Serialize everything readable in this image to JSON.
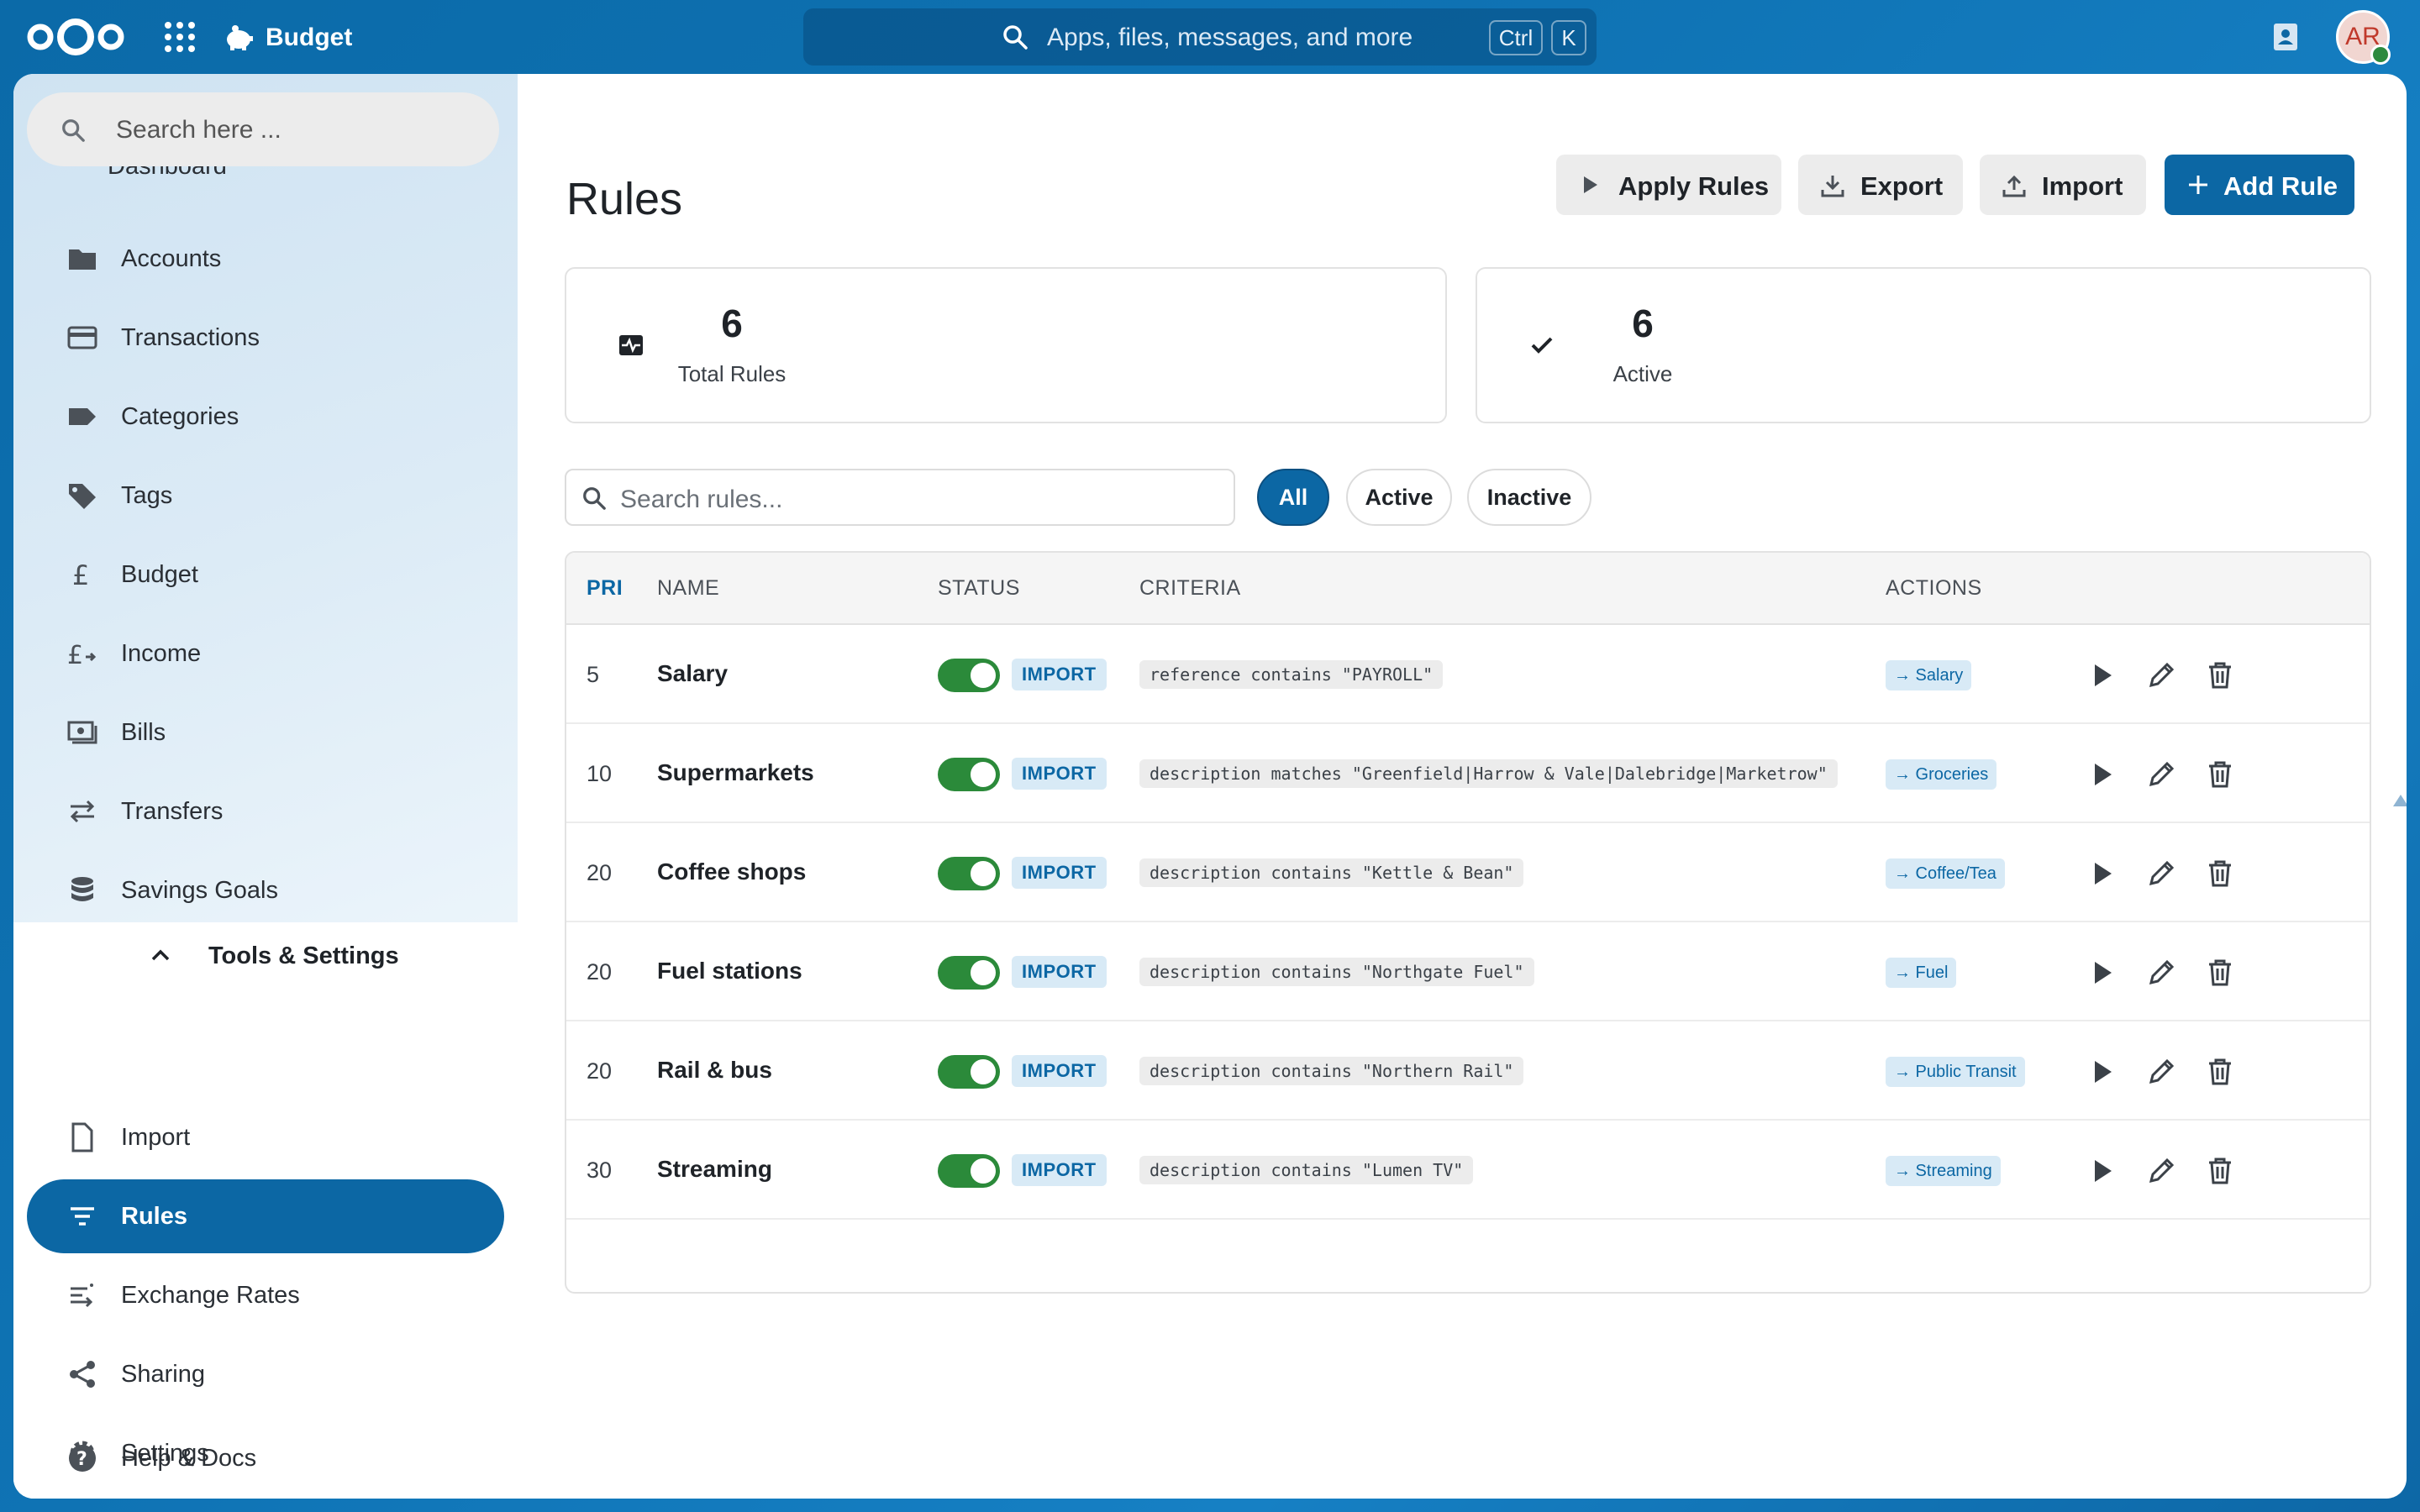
{
  "topbar": {
    "app_name": "Budget",
    "search_placeholder": "Apps, files, messages, and more",
    "shortcut_ctrl": "Ctrl",
    "shortcut_k": "K",
    "avatar_initials": "AR"
  },
  "sidebar": {
    "search_placeholder": "Search here ...",
    "cut_item": "Dashboard",
    "items": [
      {
        "label": "Accounts",
        "icon": "folder-icon"
      },
      {
        "label": "Transactions",
        "icon": "credit-card-icon"
      },
      {
        "label": "Categories",
        "icon": "label-icon"
      },
      {
        "label": "Tags",
        "icon": "tag-icon"
      },
      {
        "label": "Budget",
        "icon": "currency-icon"
      },
      {
        "label": "Income",
        "icon": "income-icon"
      },
      {
        "label": "Bills",
        "icon": "cash-icon"
      },
      {
        "label": "Transfers",
        "icon": "swap-icon"
      },
      {
        "label": "Savings Goals",
        "icon": "database-icon"
      }
    ],
    "tools_header": "Tools & Settings",
    "tools": [
      {
        "label": "Import",
        "icon": "file-icon"
      },
      {
        "label": "Rules",
        "icon": "filter-icon",
        "active": true
      },
      {
        "label": "Exchange Rates",
        "icon": "exchange-icon"
      },
      {
        "label": "Sharing",
        "icon": "share-icon"
      },
      {
        "label": "Settings",
        "icon": "gear-icon"
      },
      {
        "label": "Help & Docs",
        "icon": "help-icon"
      }
    ]
  },
  "main": {
    "title": "Rules",
    "buttons": {
      "apply": "Apply Rules",
      "export": "Export",
      "import": "Import",
      "add": "Add Rule"
    },
    "stats": {
      "total_value": "6",
      "total_label": "Total Rules",
      "active_value": "6",
      "active_label": "Active"
    },
    "search_placeholder": "Search rules...",
    "filters": {
      "all": "All",
      "active": "Active",
      "inactive": "Inactive"
    },
    "columns": {
      "pri": "PRI",
      "name": "NAME",
      "status": "STATUS",
      "criteria": "CRITERIA",
      "actions": "ACTIONS"
    },
    "rows": [
      {
        "pri": "5",
        "name": "Salary",
        "badge": "IMPORT",
        "criteria": "reference contains \"PAYROLL\"",
        "action": "→ Salary"
      },
      {
        "pri": "10",
        "name": "Supermarkets",
        "badge": "IMPORT",
        "criteria": "description matches \"Greenfield|Harrow & Vale|Dalebridge|Marketrow\"",
        "action": "→ Groceries"
      },
      {
        "pri": "20",
        "name": "Coffee shops",
        "badge": "IMPORT",
        "criteria": "description contains \"Kettle & Bean\"",
        "action": "→ Coffee/Tea"
      },
      {
        "pri": "20",
        "name": "Fuel stations",
        "badge": "IMPORT",
        "criteria": "description contains \"Northgate Fuel\"",
        "action": "→ Fuel"
      },
      {
        "pri": "20",
        "name": "Rail & bus",
        "badge": "IMPORT",
        "criteria": "description contains \"Northern Rail\"",
        "action": "→ Public Transit"
      },
      {
        "pri": "30",
        "name": "Streaming",
        "badge": "IMPORT",
        "criteria": "description contains \"Lumen TV\"",
        "action": "→ Streaming"
      }
    ]
  },
  "colors": {
    "primary": "#0c67a4",
    "toggle_on": "#2b8a3a",
    "badge_bg": "#d8eaf6"
  }
}
